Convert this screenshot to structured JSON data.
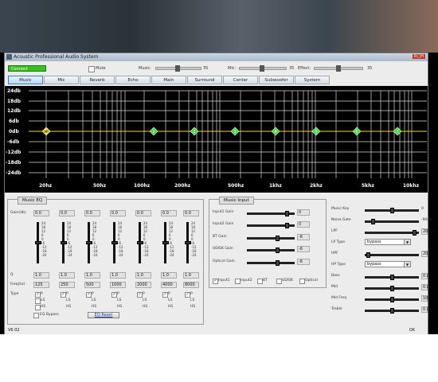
{
  "window": {
    "title": "Acoustic Professional Audio System",
    "controls": "R□H"
  },
  "toolbar": {
    "connect_label": "Connect",
    "mute_label": "Mute",
    "music_label": "Music:",
    "music_value": "35",
    "mic_label": "Mic:",
    "mic_value": "35",
    "effect_label": "Effect:",
    "effect_value": "35"
  },
  "tabs": [
    "Music",
    "Mic",
    "Reverb",
    "Echo",
    "Main",
    "Surround",
    "Center",
    "Subwoofer",
    "System"
  ],
  "graph": {
    "y_labels": [
      "24db",
      "18db",
      "12db",
      "6db",
      "0db",
      "-6db",
      "-12db",
      "-18db",
      "-24db"
    ],
    "x_labels": [
      "20hz",
      "50hz",
      "100hz",
      "200hz",
      "500hz",
      "1khz",
      "2khz",
      "5khz",
      "10khz"
    ],
    "markers": [
      "HP",
      "1",
      "2",
      "3",
      "4",
      "5",
      "6",
      "7"
    ],
    "colors": {
      "marker": "#3fd83a",
      "hp_marker": "#f4d23a",
      "curve": "#f4d23a",
      "grid": "#d8d8d8"
    }
  },
  "music_eq": {
    "title": "Music EQ",
    "gain_label": "Gain(db)",
    "q_label": "Q",
    "freq_label": "Freq(hz)",
    "type_label": "Type",
    "scale": "24\n18\n12\n6\n0\n-6\n-12\n-18\n-24",
    "bands": [
      {
        "gain": "0.0",
        "q": "1.0",
        "freq": "125"
      },
      {
        "gain": "0.0",
        "q": "1.0",
        "freq": "250"
      },
      {
        "gain": "0.0",
        "q": "1.0",
        "freq": "500"
      },
      {
        "gain": "0.0",
        "q": "1.0",
        "freq": "1000"
      },
      {
        "gain": "0.0",
        "q": "1.0",
        "freq": "2000"
      },
      {
        "gain": "0.0",
        "q": "1.0",
        "freq": "4000"
      },
      {
        "gain": "0.0",
        "q": "1.0",
        "freq": "8000"
      }
    ],
    "type_p": "P",
    "type_ls": "LS",
    "type_hs": "HS",
    "bypass_label": "EQ Bypass",
    "reset_label": "EQ Reset"
  },
  "music_input": {
    "title": "Music Input",
    "rows": [
      {
        "label": "Input1 Gain",
        "value": "0"
      },
      {
        "label": "Input2 Gain",
        "value": "0"
      },
      {
        "label": "BT Gain",
        "value": "-6"
      },
      {
        "label": "UDISK Gain",
        "value": "-6"
      },
      {
        "label": "Optical Gain",
        "value": "-6"
      }
    ],
    "sources": [
      "Input1",
      "Input2",
      "BT",
      "UDISK",
      "Optical"
    ]
  },
  "right_panel": {
    "music_key": {
      "label": "Music Key",
      "value": "0"
    },
    "noise_gate": {
      "label": "Noise Gate",
      "value": "-90db"
    },
    "lpf": {
      "label": "LPF",
      "value": "20000"
    },
    "lp_type": {
      "label": "LP Type",
      "value": "bypass"
    },
    "hpf": {
      "label": "HPF",
      "value": "20"
    },
    "hp_type": {
      "label": "HP Type",
      "value": "bypass"
    },
    "bass": {
      "label": "Bass",
      "value": "0.0"
    },
    "mid": {
      "label": "Mid",
      "value": "0.0"
    },
    "mid_freq": {
      "label": "Mid Freq",
      "value": "1000"
    },
    "treble": {
      "label": "Treble",
      "value": "0.0"
    }
  },
  "status": {
    "version": "V6.02",
    "state": "OK"
  }
}
